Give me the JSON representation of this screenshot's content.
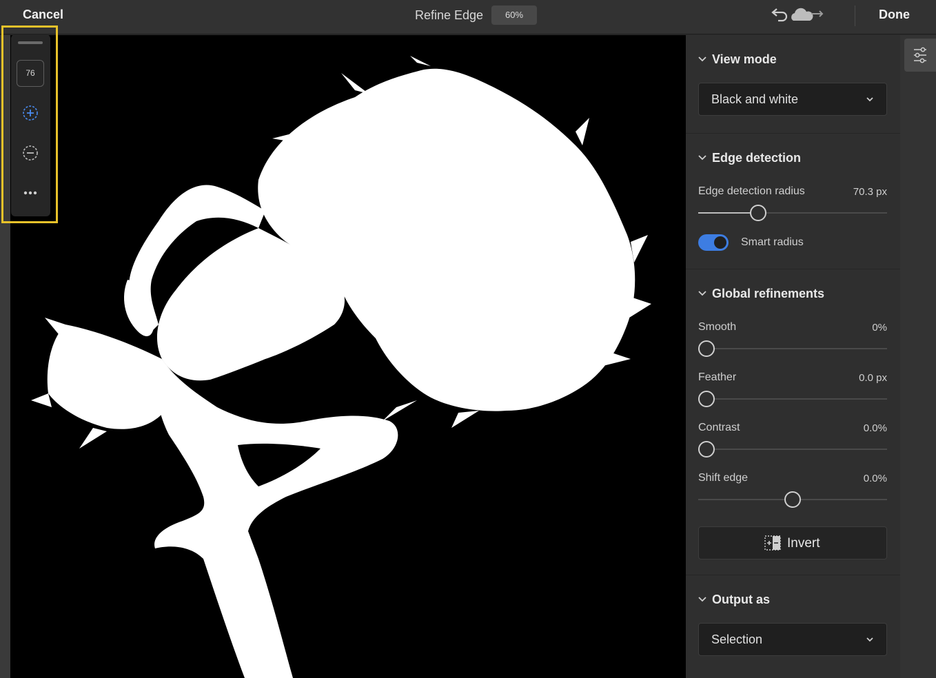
{
  "topbar": {
    "cancel_label": "Cancel",
    "title": "Refine Edge",
    "zoom": "60%",
    "done_label": "Done"
  },
  "floating_toolbar": {
    "brush_size": "76",
    "icons": [
      "add-brush-icon",
      "subtract-brush-icon",
      "more-icon"
    ]
  },
  "panel": {
    "view_mode": {
      "heading": "View mode",
      "selected": "Black and white"
    },
    "edge_detection": {
      "heading": "Edge detection",
      "radius_label": "Edge detection radius",
      "radius_value": "70.3 px",
      "radius_fraction": 0.3,
      "smart_radius_label": "Smart radius",
      "smart_radius_on": true
    },
    "global_refinements": {
      "heading": "Global refinements",
      "smooth_label": "Smooth",
      "smooth_value": "0%",
      "smooth_fraction": 0,
      "feather_label": "Feather",
      "feather_value": "0.0 px",
      "feather_fraction": 0,
      "contrast_label": "Contrast",
      "contrast_value": "0.0%",
      "contrast_fraction": 0,
      "shift_label": "Shift edge",
      "shift_value": "0.0%",
      "shift_fraction": 0.5,
      "invert_label": "Invert"
    },
    "output": {
      "heading": "Output as",
      "selected": "Selection"
    }
  },
  "colors": {
    "accent": "#3d7de2",
    "highlight": "#e8c22a",
    "panel_bg": "#2f2f2f",
    "canvas_bg": "#000000"
  }
}
